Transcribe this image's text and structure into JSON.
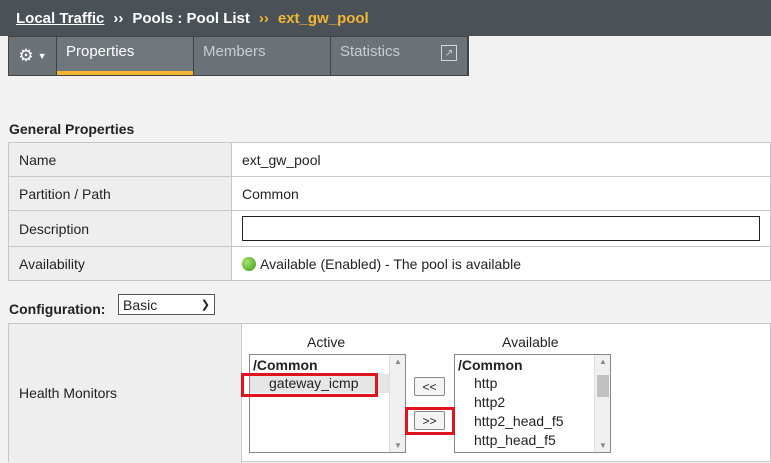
{
  "breadcrumb": {
    "root": "Local Traffic",
    "sep1": "››",
    "middle": "Pools : Pool List",
    "sep2": "››",
    "current": "ext_gw_pool"
  },
  "tabs": [
    {
      "label": "Properties",
      "active": true
    },
    {
      "label": "Members",
      "active": false
    },
    {
      "label": "Statistics",
      "active": false
    }
  ],
  "icons": {
    "gear": "gear-icon",
    "popout": "popout-icon"
  },
  "general": {
    "title": "General Properties",
    "rows": [
      {
        "label": "Name",
        "value": "ext_gw_pool"
      },
      {
        "label": "Partition / Path",
        "value": "Common"
      },
      {
        "label": "Description",
        "value": ""
      },
      {
        "label": "Availability",
        "value": "Available (Enabled) - The pool is available"
      }
    ]
  },
  "configuration": {
    "label": "Configuration:",
    "selected": "Basic"
  },
  "health_monitors": {
    "label": "Health Monitors",
    "active_header": "Active",
    "available_header": "Available",
    "active_group": "/Common",
    "active_items": [
      "gateway_icmp"
    ],
    "available_group": "/Common",
    "available_items": [
      "http",
      "http2",
      "http2_head_f5",
      "http_head_f5"
    ],
    "move_left": "<<",
    "move_right": ">>"
  },
  "colors": {
    "accent": "#f2b632",
    "highlight_box": "#e0141e",
    "header_bg": "#4a5257"
  }
}
